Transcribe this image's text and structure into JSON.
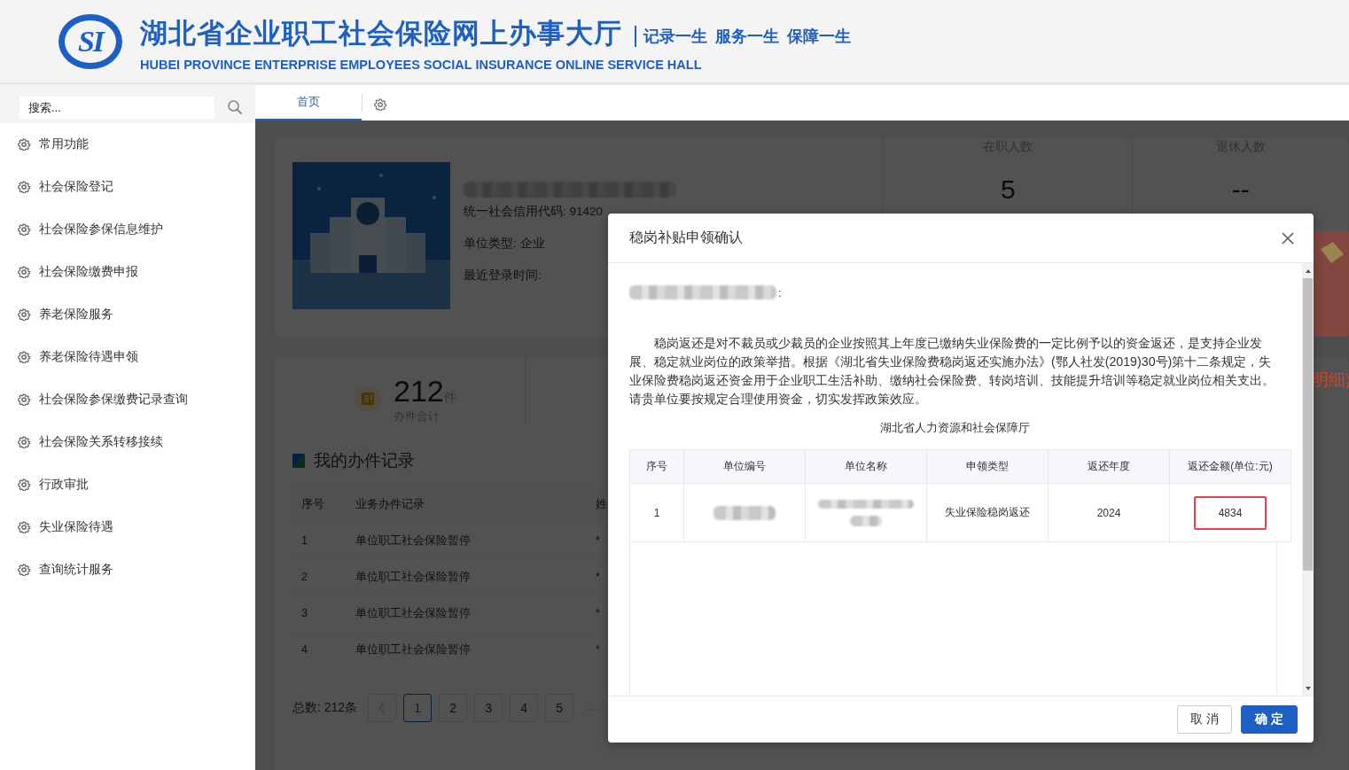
{
  "header": {
    "logo_text": "SI",
    "title": "湖北省企业职工社会保险网上办事大厅",
    "slogan": "记录一生 服务一生 保障一生",
    "subtitle": "HUBEI PROVINCE ENTERPRISE EMPLOYEES SOCIAL INSURANCE ONLINE SERVICE HALL"
  },
  "sidebar": {
    "search": {
      "placeholder": "搜索..."
    },
    "items": [
      {
        "label": "常用功能"
      },
      {
        "label": "社会保险登记"
      },
      {
        "label": "社会保险参保信息维护"
      },
      {
        "label": "社会保险缴费申报"
      },
      {
        "label": "养老保险服务"
      },
      {
        "label": "养老保险待遇申领"
      },
      {
        "label": "社会保险参保缴费记录查询"
      },
      {
        "label": "社会保险关系转移接续"
      },
      {
        "label": "行政审批"
      },
      {
        "label": "失业保险待遇"
      },
      {
        "label": "查询统计服务"
      }
    ]
  },
  "tabs": [
    {
      "label": "首页",
      "selected": true
    }
  ],
  "company": {
    "credit_code": "统一社会信用代码: 91420",
    "unit_type": "单位类型: 企业",
    "last_login": "最近登录时间:"
  },
  "stats": [
    {
      "label": "在职人数",
      "value": "5"
    },
    {
      "label": "退休人数",
      "value": "--"
    }
  ],
  "side_link": "明细)",
  "total": {
    "value": "212",
    "unit": "件",
    "label": "办件合计"
  },
  "records": {
    "title": "我的办件记录",
    "columns": [
      "序号",
      "业务办件记录",
      "姓"
    ],
    "rows": [
      [
        "1",
        "单位职工社会保险暂停",
        "*"
      ],
      [
        "2",
        "单位职工社会保险暂停",
        "*"
      ],
      [
        "3",
        "单位职工社会保险暂停",
        "*"
      ],
      [
        "4",
        "单位职工社会保险暂停",
        "*"
      ]
    ],
    "total": "总数: 212条",
    "pages": [
      {
        "label": "1",
        "selected": true
      },
      {
        "label": "2",
        "selected": false
      },
      {
        "label": "3",
        "selected": false
      },
      {
        "label": "4",
        "selected": false
      },
      {
        "label": "5",
        "selected": false
      }
    ],
    "more": "···"
  },
  "dialog": {
    "title": "稳岗补贴申领确认",
    "greeting_end": ":",
    "paragraph": "稳岗返还是对不裁员或少裁员的企业按照其上年度已缴纳失业保险费的一定比例予以的资金返还，是支持企业发展、稳定就业岗位的政策举措。根据《湖北省失业保险费稳岗返还实施办法》(鄂人社发(2019)30号)第十二条规定，失业保险费稳岗返还资金用于企业职工生活补助、缴纳社会保险费、转岗培训、技能提升培训等稳定就业岗位相关支出。请贵单位要按规定合理使用资金，切实发挥政策效应。",
    "signature": "湖北省人力资源和社会保障厅",
    "table": {
      "columns": [
        "序号",
        "单位编号",
        "单位名称",
        "申领类型",
        "返还年度",
        "返还金额(单位:元)"
      ],
      "rows": [
        {
          "index": "1",
          "type": "失业保险稳岗返还",
          "year": "2024",
          "amount": "4834",
          "highlighted": true
        }
      ]
    },
    "buttons": [
      {
        "label": "取 消",
        "kind": "secondary"
      },
      {
        "label": "确 定",
        "kind": "primary"
      }
    ]
  }
}
